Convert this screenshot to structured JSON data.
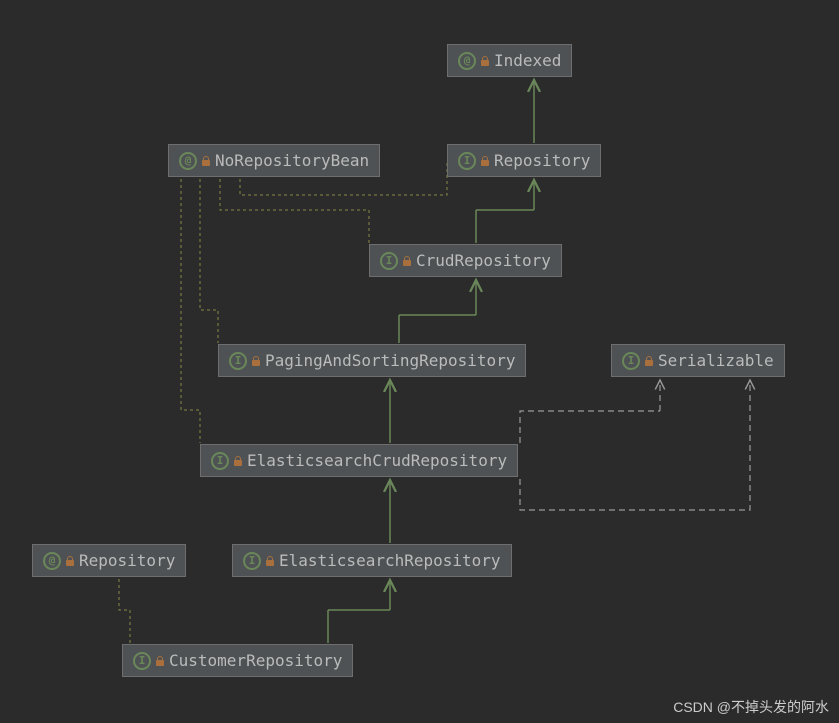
{
  "nodes": {
    "indexed": {
      "label": "Indexed",
      "icon": "@"
    },
    "noRepositoryBean": {
      "label": "NoRepositoryBean",
      "icon": "@"
    },
    "repository_top": {
      "label": "Repository",
      "icon": "I"
    },
    "crudRepository": {
      "label": "CrudRepository",
      "icon": "I"
    },
    "pagingAndSorting": {
      "label": "PagingAndSortingRepository",
      "icon": "I"
    },
    "serializable": {
      "label": "Serializable",
      "icon": "I"
    },
    "elasticsearchCrud": {
      "label": "ElasticsearchCrudRepository",
      "icon": "I"
    },
    "repository_left": {
      "label": "Repository",
      "icon": "@"
    },
    "elasticsearchRepo": {
      "label": "ElasticsearchRepository",
      "icon": "I"
    },
    "customerRepo": {
      "label": "CustomerRepository",
      "icon": "I"
    }
  },
  "watermark": "CSDN @不掉头发的阿水"
}
